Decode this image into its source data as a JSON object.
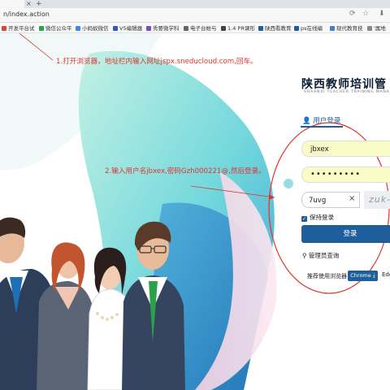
{
  "browser": {
    "tab_close": "×",
    "new_tab": "+",
    "url": "n/index.action",
    "address_buttons": [
      "⟳",
      "☆",
      "⬇"
    ],
    "bookmarks": [
      {
        "label": "开发平台试",
        "color": "#d9473a"
      },
      {
        "label": "微信公众平",
        "color": "#2aa24a"
      },
      {
        "label": "小蚂蚁微信",
        "color": "#3a8bd9"
      },
      {
        "label": "V5编辑器",
        "color": "#2f5fb5"
      },
      {
        "label": "秀要微学科",
        "color": "#7a4fb3"
      },
      {
        "label": "电子台帐与",
        "color": "#666666"
      },
      {
        "label": "1.4 PR课形",
        "color": "#444444"
      },
      {
        "label": "陕西看教育",
        "color": "#1e5f9b"
      },
      {
        "label": "ps在线编",
        "color": "#1e5f9b"
      },
      {
        "label": "现代教育技",
        "color": "#4a7fbf"
      },
      {
        "label": "'属地",
        "color": "#888888"
      }
    ]
  },
  "annotations": {
    "step1": "1.打开浏览器，地址栏内输入网址jspx.sneducloud.com,回车。",
    "step2": "2.输入用户名jbxex,密码Gzh000221@,然后登录。"
  },
  "login": {
    "system_title": "陕西教师培训管",
    "system_subtitle": "SHAANXI TEACHER TRAINING MANA",
    "tab_label": "用户登录",
    "username_value": "jbxex",
    "password_value": "•••••••••",
    "captcha_value": "7uvg",
    "captcha_clear": "×",
    "captcha_image_text": "zuk-",
    "remember_label": "保持登录",
    "login_button": "登录",
    "admin_query": "管理员查询",
    "browser_recommend": "推荐使用浏览器",
    "chrome_button": "Chrome",
    "edge_label": "Edg"
  },
  "colors": {
    "accent": "#1e5f9b",
    "annotation": "#e5322d",
    "input_fill": "#fbfbc7"
  }
}
